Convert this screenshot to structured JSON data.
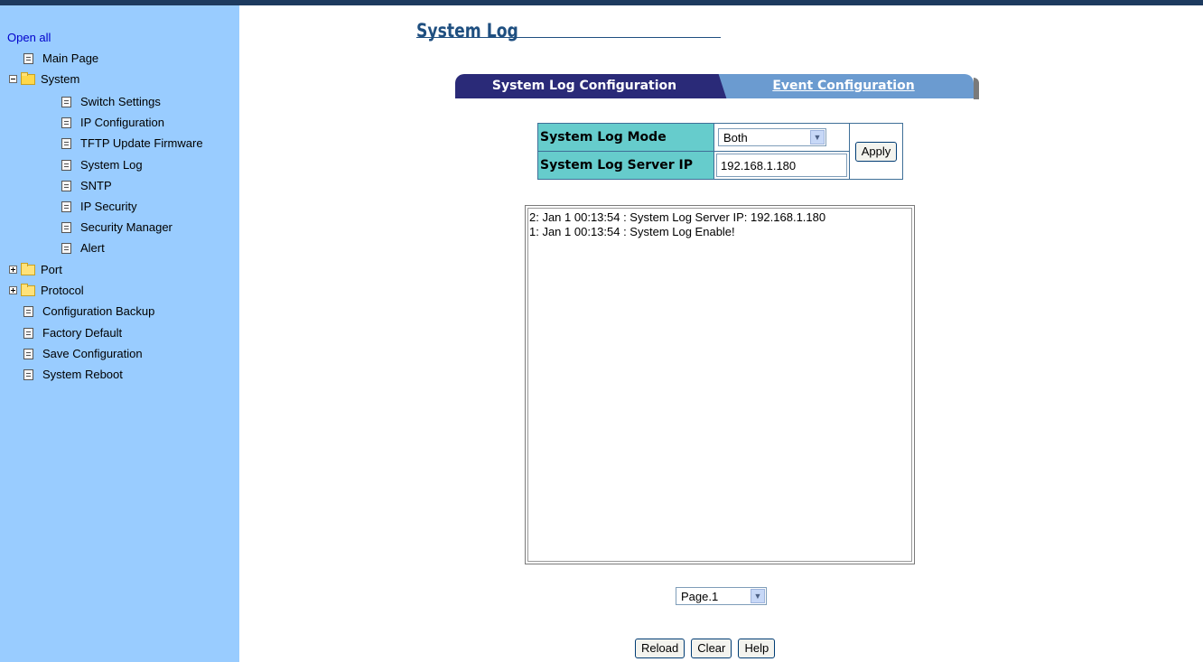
{
  "sidebar": {
    "open_all": "Open all",
    "items": [
      {
        "label": "Main Page"
      },
      {
        "label": "System"
      },
      {
        "label": "Switch Settings"
      },
      {
        "label": "IP Configuration"
      },
      {
        "label": "TFTP Update Firmware"
      },
      {
        "label": "System Log"
      },
      {
        "label": "SNTP"
      },
      {
        "label": "IP Security"
      },
      {
        "label": "Security Manager"
      },
      {
        "label": "Alert"
      },
      {
        "label": "Port"
      },
      {
        "label": "Protocol"
      },
      {
        "label": "Configuration Backup"
      },
      {
        "label": "Factory Default"
      },
      {
        "label": "Save Configuration"
      },
      {
        "label": "System Reboot"
      }
    ]
  },
  "main": {
    "title": "System Log",
    "tabs": [
      {
        "label": "System Log Configuration"
      },
      {
        "label": "Event Configuration"
      }
    ],
    "config": {
      "mode_label": "System Log Mode",
      "mode_value": "Both",
      "server_label": "System Log Server IP",
      "server_value": "192.168.1.180",
      "apply_label": "Apply"
    },
    "log_lines": [
      "2: Jan 1 00:13:54 : System Log Server IP: 192.168.1.180",
      "1: Jan 1 00:13:54 : System Log Enable!"
    ],
    "page_select": "Page.1",
    "buttons": {
      "reload": "Reload",
      "clear": "Clear",
      "help": "Help"
    }
  },
  "colors": {
    "sidebar_bg": "#99ccff",
    "tab_active": "#2a2a78",
    "tab_inactive": "#6b9bd0",
    "label_bg": "#66cccc",
    "title": "#1f4f80"
  }
}
